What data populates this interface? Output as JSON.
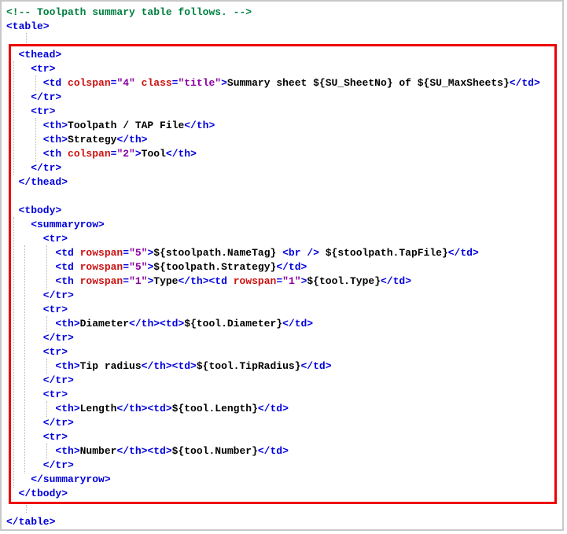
{
  "colors": {
    "comment": "#008040",
    "tag": "#0000dd",
    "attr": "#cc1111",
    "value": "#8a00a0",
    "text": "#000000",
    "highlight": "#ee0000",
    "frame": "#c8c8c8",
    "guide": "#b5b5b5"
  },
  "highlight_box": {
    "purpose": "red emphasis rectangle around the thead and tbody sections of the code sample"
  },
  "code": {
    "language": "xml-template",
    "lines": [
      {
        "tokens": [
          {
            "c": "cm",
            "s": "<!-- Toolpath summary table follows. -->"
          }
        ]
      },
      {
        "tokens": [
          {
            "c": "tg",
            "s": "<table>"
          }
        ]
      },
      {
        "tokens": []
      },
      {
        "tokens": [
          {
            "c": "tg",
            "s": "  <thead>"
          }
        ]
      },
      {
        "tokens": [
          {
            "c": "tg",
            "s": "    <tr>"
          }
        ]
      },
      {
        "tokens": [
          {
            "c": "tg",
            "s": "      <td"
          },
          {
            "c": "at",
            "s": " colspan"
          },
          {
            "c": "tg",
            "s": "="
          },
          {
            "c": "vl",
            "s": "\"4\""
          },
          {
            "c": "at",
            "s": " class"
          },
          {
            "c": "tg",
            "s": "="
          },
          {
            "c": "vl",
            "s": "\"title\""
          },
          {
            "c": "tg",
            "s": ">"
          },
          {
            "c": "tx",
            "s": "Summary sheet ${SU_SheetNo} of ${SU_MaxSheets}"
          },
          {
            "c": "tg",
            "s": "</td>"
          }
        ]
      },
      {
        "tokens": [
          {
            "c": "tg",
            "s": "    </tr>"
          }
        ]
      },
      {
        "tokens": [
          {
            "c": "tg",
            "s": "    <tr>"
          }
        ]
      },
      {
        "tokens": [
          {
            "c": "tg",
            "s": "      <th>"
          },
          {
            "c": "tx",
            "s": "Toolpath / TAP File"
          },
          {
            "c": "tg",
            "s": "</th>"
          }
        ]
      },
      {
        "tokens": [
          {
            "c": "tg",
            "s": "      <th>"
          },
          {
            "c": "tx",
            "s": "Strategy"
          },
          {
            "c": "tg",
            "s": "</th>"
          }
        ]
      },
      {
        "tokens": [
          {
            "c": "tg",
            "s": "      <th"
          },
          {
            "c": "at",
            "s": " colspan"
          },
          {
            "c": "tg",
            "s": "="
          },
          {
            "c": "vl",
            "s": "\"2\""
          },
          {
            "c": "tg",
            "s": ">"
          },
          {
            "c": "tx",
            "s": "Tool"
          },
          {
            "c": "tg",
            "s": "</th>"
          }
        ]
      },
      {
        "tokens": [
          {
            "c": "tg",
            "s": "    </tr>"
          }
        ]
      },
      {
        "tokens": [
          {
            "c": "tg",
            "s": "  </thead>"
          }
        ]
      },
      {
        "tokens": []
      },
      {
        "tokens": [
          {
            "c": "tg",
            "s": "  <tbody>"
          }
        ]
      },
      {
        "tokens": [
          {
            "c": "tg",
            "s": "    <summaryrow>"
          }
        ]
      },
      {
        "tokens": [
          {
            "c": "tg",
            "s": "      <tr>"
          }
        ]
      },
      {
        "tokens": [
          {
            "c": "tg",
            "s": "        <td"
          },
          {
            "c": "at",
            "s": " rowspan"
          },
          {
            "c": "tg",
            "s": "="
          },
          {
            "c": "vl",
            "s": "\"5\""
          },
          {
            "c": "tg",
            "s": ">"
          },
          {
            "c": "tx",
            "s": "${stoolpath.NameTag} "
          },
          {
            "c": "tg",
            "s": "<br />"
          },
          {
            "c": "tx",
            "s": " ${stoolpath.TapFile}"
          },
          {
            "c": "tg",
            "s": "</td>"
          }
        ]
      },
      {
        "tokens": [
          {
            "c": "tg",
            "s": "        <td"
          },
          {
            "c": "at",
            "s": " rowspan"
          },
          {
            "c": "tg",
            "s": "="
          },
          {
            "c": "vl",
            "s": "\"5\""
          },
          {
            "c": "tg",
            "s": ">"
          },
          {
            "c": "tx",
            "s": "${toolpath.Strategy}"
          },
          {
            "c": "tg",
            "s": "</td>"
          }
        ]
      },
      {
        "tokens": [
          {
            "c": "tg",
            "s": "        <th"
          },
          {
            "c": "at",
            "s": " rowspan"
          },
          {
            "c": "tg",
            "s": "="
          },
          {
            "c": "vl",
            "s": "\"1\""
          },
          {
            "c": "tg",
            "s": ">"
          },
          {
            "c": "tx",
            "s": "Type"
          },
          {
            "c": "tg",
            "s": "</th><td"
          },
          {
            "c": "at",
            "s": " rowspan"
          },
          {
            "c": "tg",
            "s": "="
          },
          {
            "c": "vl",
            "s": "\"1\""
          },
          {
            "c": "tg",
            "s": ">"
          },
          {
            "c": "tx",
            "s": "${tool.Type}"
          },
          {
            "c": "tg",
            "s": "</td>"
          }
        ]
      },
      {
        "tokens": [
          {
            "c": "tg",
            "s": "      </tr>"
          }
        ]
      },
      {
        "tokens": [
          {
            "c": "tg",
            "s": "      <tr>"
          }
        ]
      },
      {
        "tokens": [
          {
            "c": "tg",
            "s": "        <th>"
          },
          {
            "c": "tx",
            "s": "Diameter"
          },
          {
            "c": "tg",
            "s": "</th><td>"
          },
          {
            "c": "tx",
            "s": "${tool.Diameter}"
          },
          {
            "c": "tg",
            "s": "</td>"
          }
        ]
      },
      {
        "tokens": [
          {
            "c": "tg",
            "s": "      </tr>"
          }
        ]
      },
      {
        "tokens": [
          {
            "c": "tg",
            "s": "      <tr>"
          }
        ]
      },
      {
        "tokens": [
          {
            "c": "tg",
            "s": "        <th>"
          },
          {
            "c": "tx",
            "s": "Tip radius"
          },
          {
            "c": "tg",
            "s": "</th><td>"
          },
          {
            "c": "tx",
            "s": "${tool.TipRadius}"
          },
          {
            "c": "tg",
            "s": "</td>"
          }
        ]
      },
      {
        "tokens": [
          {
            "c": "tg",
            "s": "      </tr>"
          }
        ]
      },
      {
        "tokens": [
          {
            "c": "tg",
            "s": "      <tr>"
          }
        ]
      },
      {
        "tokens": [
          {
            "c": "tg",
            "s": "        <th>"
          },
          {
            "c": "tx",
            "s": "Length"
          },
          {
            "c": "tg",
            "s": "</th><td>"
          },
          {
            "c": "tx",
            "s": "${tool.Length}"
          },
          {
            "c": "tg",
            "s": "</td>"
          }
        ]
      },
      {
        "tokens": [
          {
            "c": "tg",
            "s": "      </tr>"
          }
        ]
      },
      {
        "tokens": [
          {
            "c": "tg",
            "s": "      <tr>"
          }
        ]
      },
      {
        "tokens": [
          {
            "c": "tg",
            "s": "        <th>"
          },
          {
            "c": "tx",
            "s": "Number"
          },
          {
            "c": "tg",
            "s": "</th><td>"
          },
          {
            "c": "tx",
            "s": "${tool.Number}"
          },
          {
            "c": "tg",
            "s": "</td>"
          }
        ]
      },
      {
        "tokens": [
          {
            "c": "tg",
            "s": "      </tr>"
          }
        ]
      },
      {
        "tokens": [
          {
            "c": "tg",
            "s": "    </summaryrow>"
          }
        ]
      },
      {
        "tokens": [
          {
            "c": "tg",
            "s": "  </tbody>"
          }
        ]
      },
      {
        "tokens": []
      },
      {
        "tokens": [
          {
            "c": "tg",
            "s": "</table>"
          }
        ]
      }
    ]
  }
}
